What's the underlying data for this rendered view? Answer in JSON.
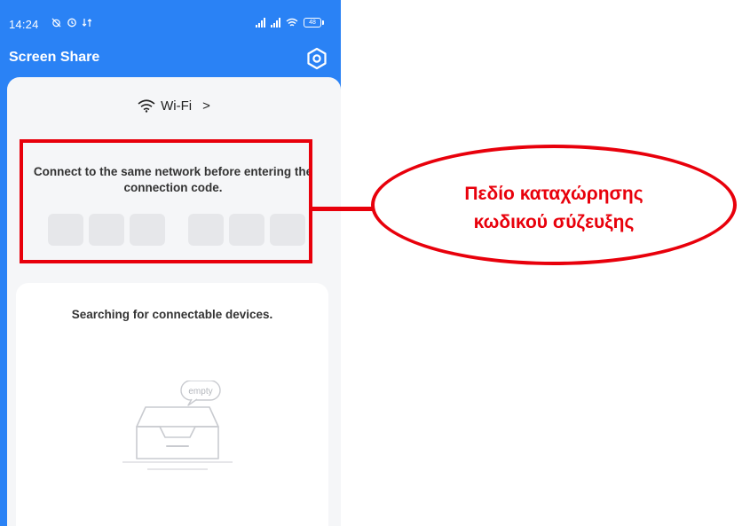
{
  "status_bar": {
    "time": "14:24",
    "battery_level": "48"
  },
  "header": {
    "title": "Screen Share",
    "settings_icon": "settings-hexagon-icon"
  },
  "network": {
    "label": "Wi-Fi",
    "chevron": ">"
  },
  "pairing": {
    "instructions": "Connect to the same network before entering the connection code.",
    "code_digits": [
      "",
      "",
      "",
      "",
      "",
      ""
    ]
  },
  "devices": {
    "searching_text": "Searching for connectable devices.",
    "empty_badge": "empty"
  },
  "annotation": {
    "callout_line1": "Πεδίο καταχώρησης",
    "callout_line2": "κωδικού σύζευξης",
    "color": "#e8000b"
  },
  "colors": {
    "header_blue": "#2a82f5",
    "content_bg": "#f5f6f8",
    "code_box": "#e6e7ea"
  }
}
